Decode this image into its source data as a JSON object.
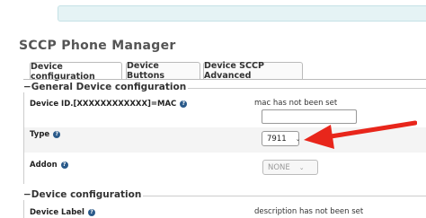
{
  "page": {
    "title": "SCCP Phone Manager"
  },
  "tabs": [
    {
      "label": "Device configuration",
      "active": true
    },
    {
      "label": "Device Buttons",
      "active": false
    },
    {
      "label": "Device SCCP Advanced",
      "active": false
    }
  ],
  "sections": {
    "general": {
      "legend": "−General Device configuration"
    },
    "device": {
      "legend": "−Device configuration"
    }
  },
  "fields": {
    "device_id": {
      "label": "Device ID.[XXXXXXXXXXXX]=MAC",
      "note": "mac has not been set",
      "value": ""
    },
    "type": {
      "label": "Type",
      "selected": "7911"
    },
    "addon": {
      "label": "Addon",
      "selected": "NONE"
    },
    "device_label": {
      "label": "Device Label",
      "note": "description has not been set"
    }
  },
  "icons": {
    "help": "?"
  },
  "colors": {
    "arrow": "#e8261b",
    "help_icon": "#2a5a8a",
    "info_bar": "#e5f3f5"
  }
}
